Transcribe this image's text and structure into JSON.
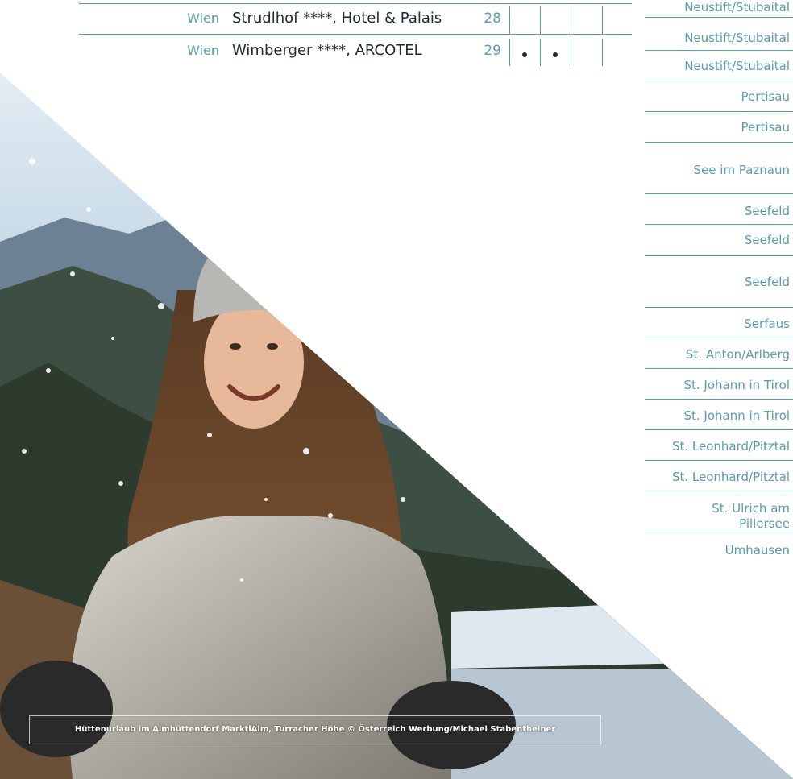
{
  "hotels": [
    {
      "city": "Wien",
      "name": "Strudlhof ****, Hotel & Palais",
      "page": "28",
      "marks": [
        false,
        false,
        false
      ]
    },
    {
      "city": "Wien",
      "name": "Wimberger ****, ARCOTEL",
      "page": "29",
      "marks": [
        true,
        true,
        false
      ]
    }
  ],
  "locations": [
    "Neustift/Stubaital",
    "Neustift/Stubaital",
    "Neustift/Stubaital",
    "Pertisau",
    "Pertisau",
    "See im Paznaun",
    "Seefeld",
    "Seefeld",
    "Seefeld",
    "Serfaus",
    "St. Anton/Arlberg",
    "St. Johann in Tirol",
    "St. Johann in Tirol",
    "St. Leonhard/Pitztal",
    "St. Leonhard/Pitztal",
    "St. Ulrich am Pillersee",
    "Umhausen"
  ],
  "caption": "Hüttenurlaub im Almhüttendorf MarktlAlm, Turracher Höhe © Österreich Werbung/Michael Stabentheiner",
  "colors": {
    "accent": "#5a9daa",
    "text": "#1e2a30"
  }
}
